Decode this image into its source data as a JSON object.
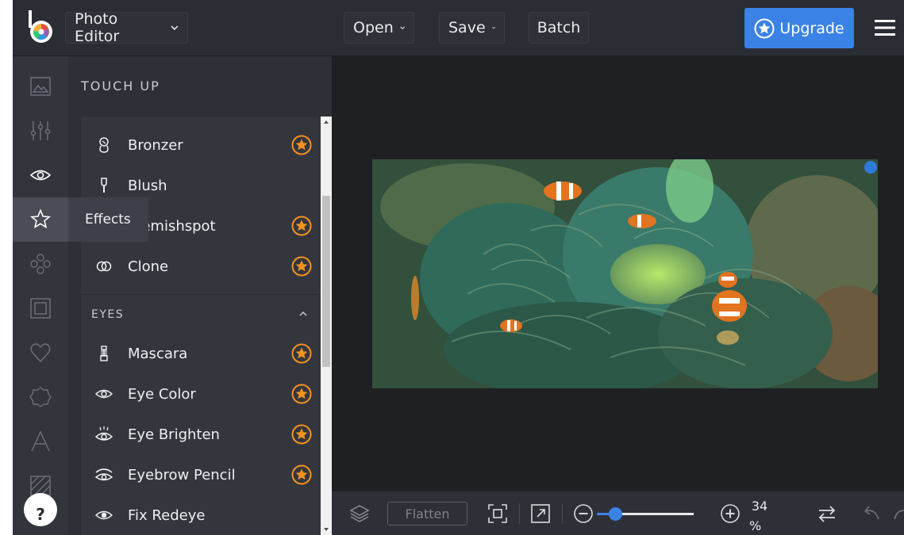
{
  "header": {
    "app_menu_label": "Photo Editor",
    "open_label": "Open",
    "save_label": "Save",
    "batch_label": "Batch",
    "upgrade_label": "Upgrade"
  },
  "rail": {
    "items": [
      "image-icon",
      "sliders-icon",
      "eye-icon",
      "star-icon",
      "circles-icon",
      "frame-icon",
      "heart-icon",
      "badge-icon",
      "text-icon",
      "texture-icon"
    ],
    "active": "star-icon",
    "help_label": "?"
  },
  "tooltip": {
    "label": "Effects"
  },
  "panel": {
    "title": "TOUCH UP",
    "tools": [
      {
        "label": "Bronzer",
        "icon": "bronzer-icon",
        "premium": true
      },
      {
        "label": "Blush",
        "icon": "brush-icon",
        "premium": false
      },
      {
        "label": "Blemishspot",
        "icon": "spot-icon",
        "premium": true
      },
      {
        "label": "Clone",
        "icon": "clone-icon",
        "premium": true
      }
    ],
    "section": {
      "label": "EYES",
      "state": "expanded"
    },
    "eye_tools": [
      {
        "label": "Mascara",
        "icon": "mascara-icon",
        "premium": true
      },
      {
        "label": "Eye Color",
        "icon": "eye-icon",
        "premium": true
      },
      {
        "label": "Eye Brighten",
        "icon": "eye-brighten-icon",
        "premium": true
      },
      {
        "label": "Eyebrow Pencil",
        "icon": "eyebrow-icon",
        "premium": true
      },
      {
        "label": "Fix Redeye",
        "icon": "redeye-icon",
        "premium": false
      }
    ]
  },
  "toolbar": {
    "flatten_label": "Flatten",
    "zoom_value": "34",
    "zoom_unit": "%",
    "zoom_fraction": 0.1
  },
  "colors": {
    "accent": "#3b82e6",
    "premium_star": "#f5921e",
    "background": "#2a2c33"
  }
}
